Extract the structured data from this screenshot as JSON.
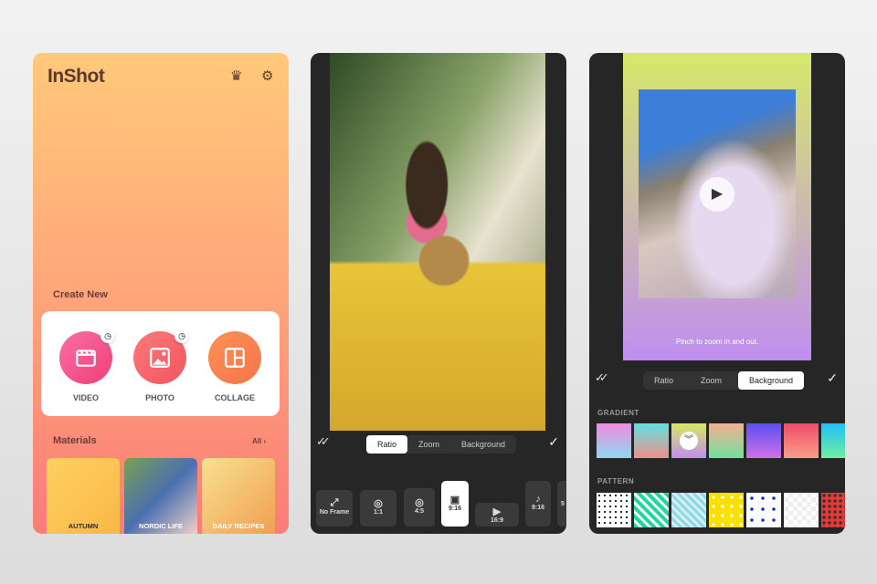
{
  "home": {
    "logo": "InShot",
    "create_new": "Create New",
    "buttons": [
      {
        "label": "VIDEO"
      },
      {
        "label": "PHOTO"
      },
      {
        "label": "COLLAGE"
      }
    ],
    "materials": "Materials",
    "all": "All ›",
    "materials_items": [
      "AUTUMN",
      "NORDIC LIFE",
      "DAILY RECIPES"
    ]
  },
  "editor": {
    "tabs": [
      "Ratio",
      "Zoom",
      "Background"
    ],
    "active_tab": "Ratio",
    "ratios": [
      "No Frame",
      "1:1",
      "4:5",
      "9:16",
      "16:9",
      "9:16",
      "5"
    ],
    "selected_ratio": "9:16"
  },
  "background": {
    "tabs": [
      "Ratio",
      "Zoom",
      "Background"
    ],
    "active_tab": "Background",
    "hint": "Pinch to zoom in and out.",
    "gradient_label": "GRADIENT",
    "pattern_label": "PATTERN",
    "gradients": [
      [
        "#f08be0",
        "#8fd8f0"
      ],
      [
        "#5fe0e0",
        "#f0908a"
      ],
      [
        "#d8e860",
        "#c28ef0"
      ],
      [
        "#f5b090",
        "#70e0a0"
      ],
      [
        "#5a50f0",
        "#d070e8"
      ],
      [
        "#f04a6a",
        "#f8a088"
      ],
      [
        "#20c0f8",
        "#70f0a0"
      ]
    ]
  }
}
